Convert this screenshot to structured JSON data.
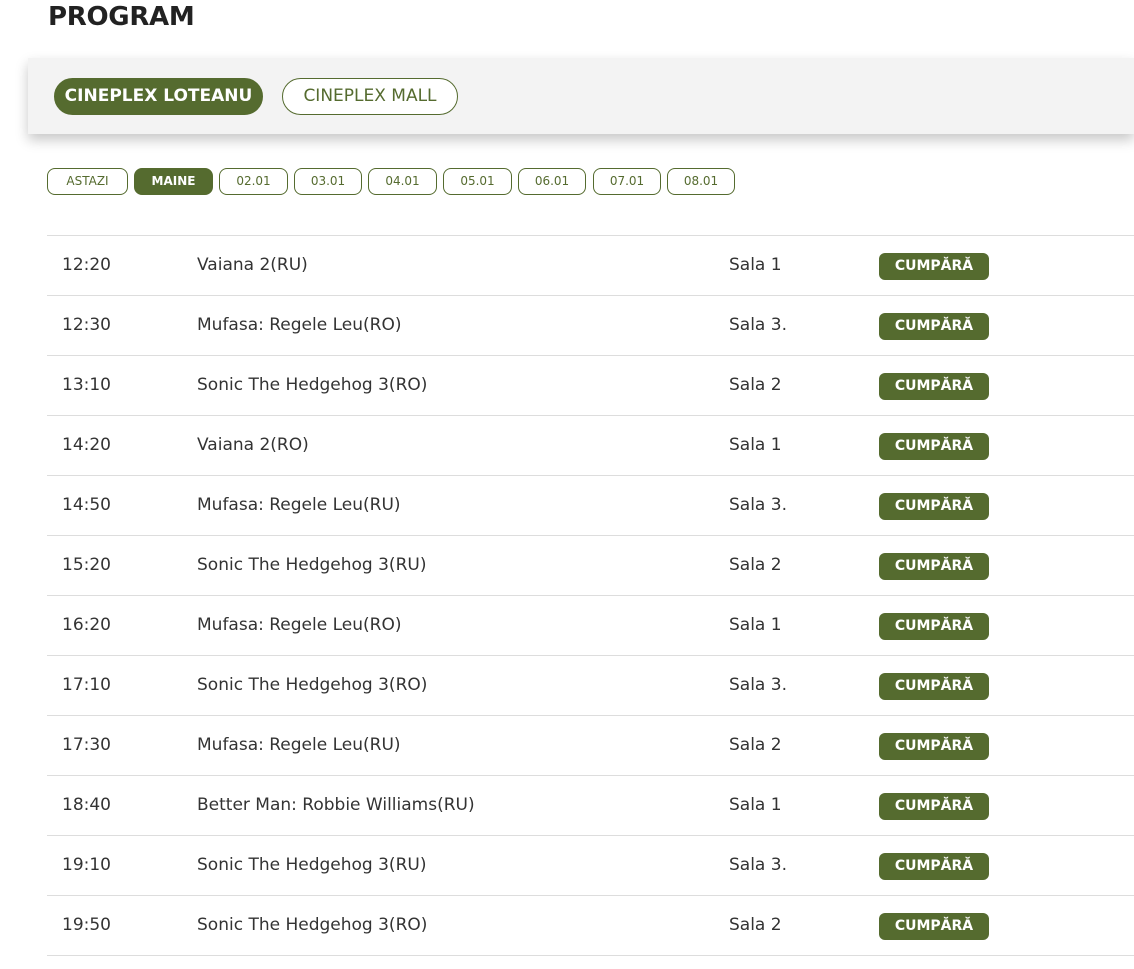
{
  "page": {
    "title": "PROGRAM"
  },
  "cinemas": [
    {
      "label": "CINEPLEX LOTEANU",
      "active": true
    },
    {
      "label": "CINEPLEX MALL",
      "active": false
    }
  ],
  "dates": [
    {
      "label": "ASTAZI",
      "active": false
    },
    {
      "label": "MAINE",
      "active": true
    },
    {
      "label": "02.01",
      "active": false
    },
    {
      "label": "03.01",
      "active": false
    },
    {
      "label": "04.01",
      "active": false
    },
    {
      "label": "05.01",
      "active": false
    },
    {
      "label": "06.01",
      "active": false
    },
    {
      "label": "07.01",
      "active": false
    },
    {
      "label": "08.01",
      "active": false
    }
  ],
  "buy_label": "CUMPĂRĂ",
  "showtimes": [
    {
      "time": "12:20",
      "film": "Vaiana 2(RU)",
      "hall": "Sala 1"
    },
    {
      "time": "12:30",
      "film": "Mufasa: Regele Leu(RO)",
      "hall": "Sala 3."
    },
    {
      "time": "13:10",
      "film": "Sonic The Hedgehog 3(RO)",
      "hall": "Sala 2"
    },
    {
      "time": "14:20",
      "film": "Vaiana 2(RO)",
      "hall": "Sala 1"
    },
    {
      "time": "14:50",
      "film": "Mufasa: Regele Leu(RU)",
      "hall": "Sala 3."
    },
    {
      "time": "15:20",
      "film": "Sonic The Hedgehog 3(RU)",
      "hall": "Sala 2"
    },
    {
      "time": "16:20",
      "film": "Mufasa: Regele Leu(RO)",
      "hall": "Sala 1"
    },
    {
      "time": "17:10",
      "film": "Sonic The Hedgehog 3(RO)",
      "hall": "Sala 3."
    },
    {
      "time": "17:30",
      "film": "Mufasa: Regele Leu(RU)",
      "hall": "Sala 2"
    },
    {
      "time": "18:40",
      "film": "Better Man: Robbie Williams(RU)",
      "hall": "Sala 1"
    },
    {
      "time": "19:10",
      "film": "Sonic The Hedgehog 3(RU)",
      "hall": "Sala 3."
    },
    {
      "time": "19:50",
      "film": "Sonic The Hedgehog 3(RO)",
      "hall": "Sala 2"
    }
  ],
  "colors": {
    "accent": "#556b2f",
    "bar_background": "#f3f3f3",
    "divider": "#dddddd"
  }
}
